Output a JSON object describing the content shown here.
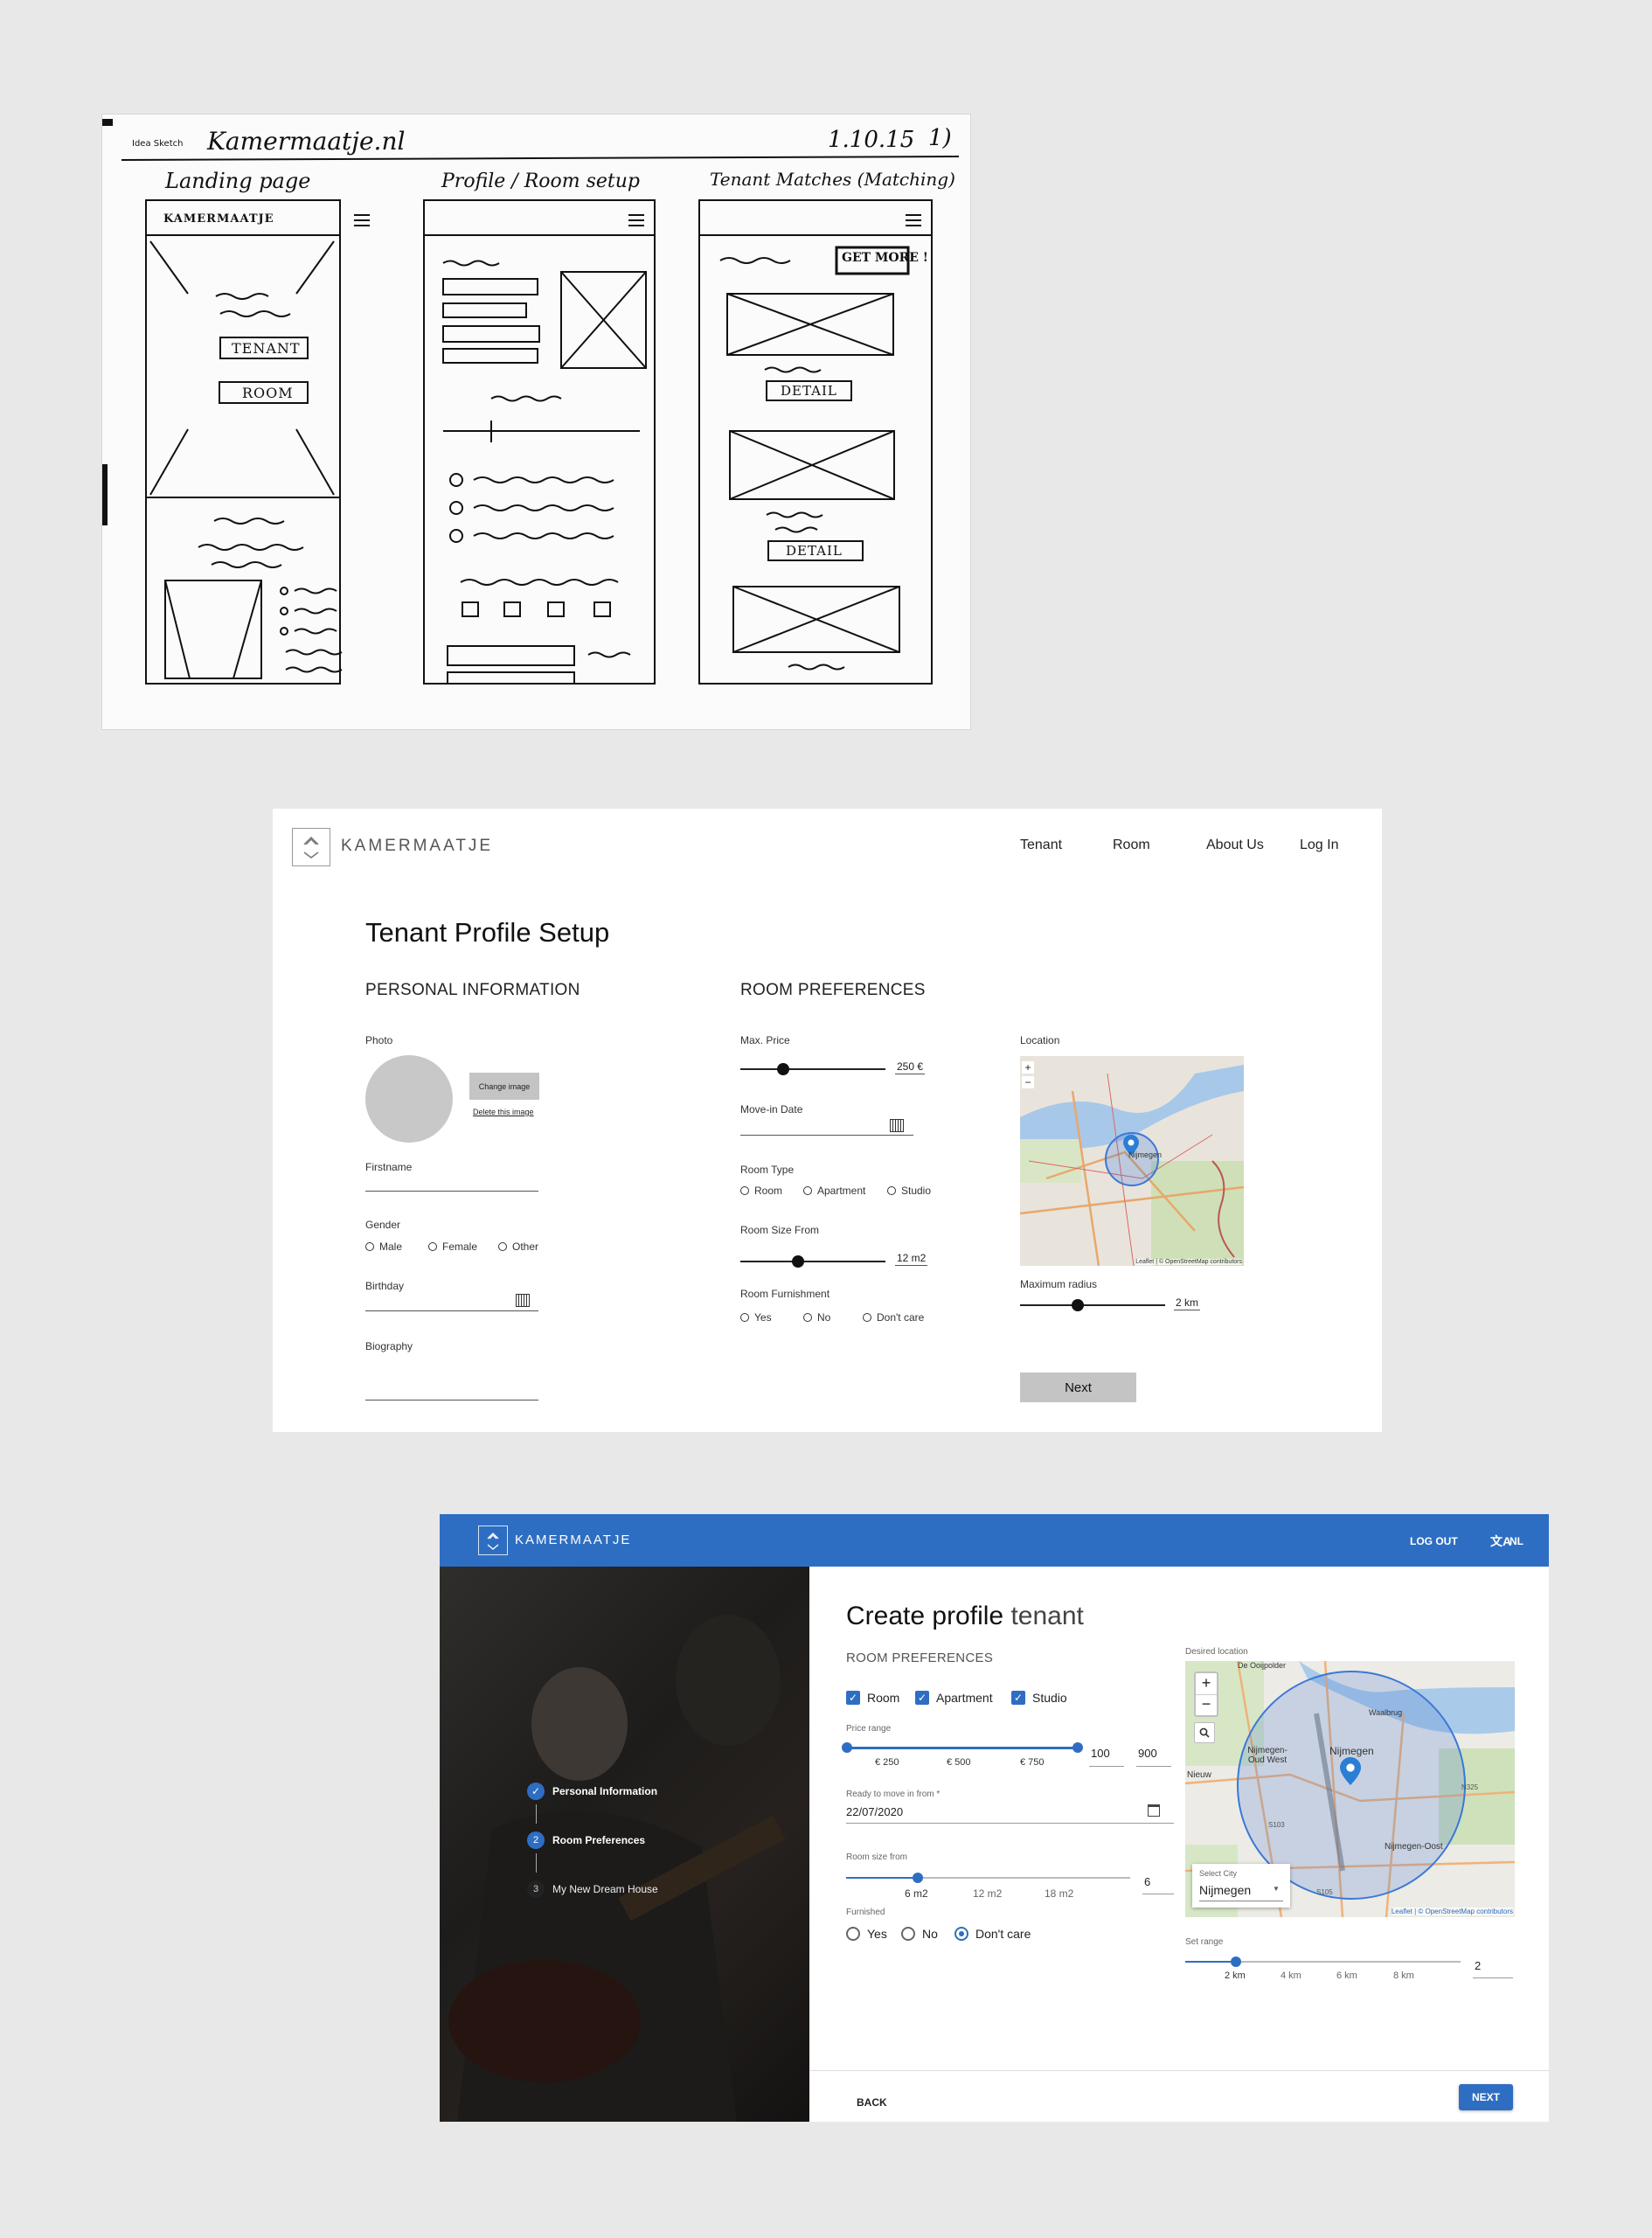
{
  "sketch": {
    "app_title": "Kamermaatje.nl",
    "pre_label": "Idea Sketch",
    "version": "1.10.15",
    "page_no": "1)",
    "columns": [
      {
        "title": "Landing page",
        "brand": "KAMERMAATJE",
        "buttons": [
          "TENANT",
          "ROOM"
        ]
      },
      {
        "title": "Profile / Room setup"
      },
      {
        "title": "Tenant Matches (Matching)",
        "cta": "GET MORE !",
        "buttons": [
          "DETAIL",
          "DETAIL"
        ]
      }
    ]
  },
  "wireframe": {
    "brand": "KAMERMAATJE",
    "nav": [
      "Tenant",
      "Room",
      "About Us",
      "Log In"
    ],
    "page_title": "Tenant Profile Setup",
    "personal": {
      "heading": "PERSONAL INFORMATION",
      "photo_label": "Photo",
      "change_image": "Change image",
      "delete_image": "Delete this image",
      "firstname_label": "Firstname",
      "gender_label": "Gender",
      "gender_options": [
        "Male",
        "Female",
        "Other"
      ],
      "birthday_label": "Birthday",
      "biography_label": "Biography"
    },
    "room": {
      "heading": "ROOM PREFERENCES",
      "max_price_label": "Max. Price",
      "max_price_value": "250 €",
      "move_in_label": "Move-in Date",
      "room_type_label": "Room Type",
      "room_type_options": [
        "Room",
        "Apartment",
        "Studio"
      ],
      "room_size_label": "Room Size From",
      "room_size_value": "12 m2",
      "furnishment_label": "Room Furnishment",
      "furnishment_options": [
        "Yes",
        "No",
        "Don't care"
      ]
    },
    "location": {
      "label": "Location",
      "map_city": "Nijmegen",
      "map_attrib": "Leaflet | © OpenStreetMap contributors",
      "radius_label": "Maximum radius",
      "radius_value": "2 km",
      "next": "Next"
    }
  },
  "app": {
    "brand": "KAMERMAATJE",
    "logout": "LOG OUT",
    "lang": "NL",
    "steps": [
      {
        "num": "✓",
        "label": "Personal Information"
      },
      {
        "num": "2",
        "label": "Room Preferences"
      },
      {
        "num": "3",
        "label": "My New Dream House"
      }
    ],
    "title_bold": "Create profile",
    "title_light": "tenant",
    "section": "ROOM PREFERENCES",
    "types": [
      "Room",
      "Apartment",
      "Studio"
    ],
    "price_label": "Price range",
    "price_ticks": [
      "€ 250",
      "€ 500",
      "€ 750"
    ],
    "price_min": "100",
    "price_max": "900",
    "movein_label": "Ready to move in from *",
    "movein_value": "22/07/2020",
    "size_label": "Room size from",
    "size_ticks": [
      "6 m2",
      "12 m2",
      "18 m2"
    ],
    "size_value": "6",
    "furnished_label": "Furnished",
    "furnished_options": [
      "Yes",
      "No",
      "Don't care"
    ],
    "furnished_selected": "Don't care",
    "location_label": "Desired location",
    "map_places": [
      "De Ooijpolder",
      "Waalbrug",
      "Nijmegen-Oud West",
      "Nijmegen",
      "Nijmegen-Oost",
      "Nieuw"
    ],
    "map_roads": [
      "S103",
      "N325",
      "S105"
    ],
    "map_attrib": "Leaflet | © OpenStreetMap contributors",
    "city_label": "Select City",
    "city_value": "Nijmegen",
    "range_label": "Set range",
    "range_ticks": [
      "2 km",
      "4 km",
      "6 km",
      "8 km"
    ],
    "range_value": "2",
    "back": "BACK",
    "next": "NEXT"
  }
}
